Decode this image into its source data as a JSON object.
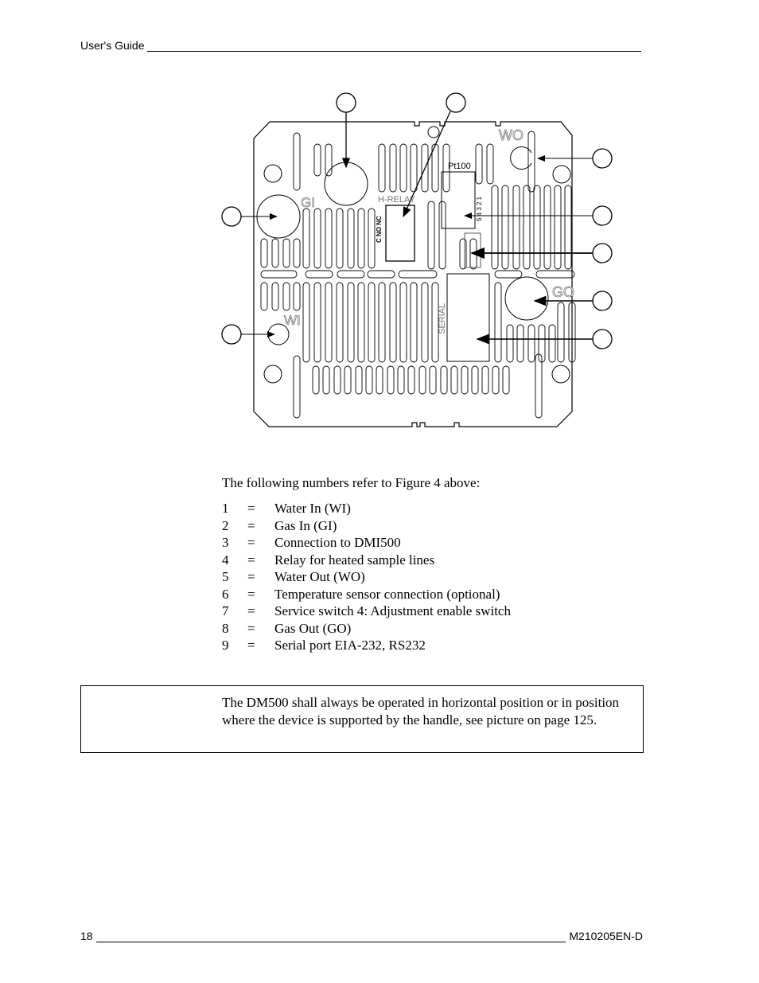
{
  "header": {
    "title": "User's Guide"
  },
  "figure": {
    "labels": {
      "gi": "GI",
      "wi": "WI",
      "wo": "WO",
      "go": "GO",
      "h_relay": "H-RELAY",
      "relay_pins": "C  NO  NC",
      "pt100": "Pt100",
      "pt100_pins": "5 4 3 2 1",
      "serial": "SERIAL"
    }
  },
  "body": {
    "intro": "The following numbers refer to Figure 4 above:",
    "items": [
      {
        "num": "1",
        "eq": "=",
        "text": "Water In (WI)"
      },
      {
        "num": "2",
        "eq": "=",
        "text": "Gas In (GI)"
      },
      {
        "num": "3",
        "eq": "=",
        "text": "Connection to DMI500"
      },
      {
        "num": "4",
        "eq": "=",
        "text": "Relay for heated sample lines"
      },
      {
        "num": "5",
        "eq": "=",
        "text": "Water Out (WO)"
      },
      {
        "num": "6",
        "eq": "=",
        "text": "Temperature sensor connection (optional)"
      },
      {
        "num": "7",
        "eq": "=",
        "text": "Service switch 4: Adjustment enable switch"
      },
      {
        "num": "8",
        "eq": "=",
        "text": "Gas Out (GO)"
      },
      {
        "num": "9",
        "eq": "=",
        "text": "Serial port EIA-232, RS232"
      }
    ],
    "note": "The DM500 shall always be operated in horizontal position or in position where the device is supported by the handle, see picture on page 125."
  },
  "footer": {
    "page": "18",
    "doc_id": "M210205EN-D"
  }
}
